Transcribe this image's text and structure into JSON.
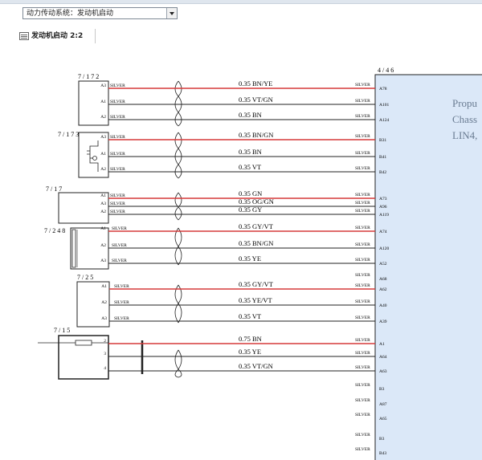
{
  "toolbar": {
    "system_select_value": "动力传动系统：发动机启动",
    "page_label": "发动机启动 2:2"
  },
  "ecu": {
    "id": "4 / 4 6",
    "text_lines": [
      "Propu",
      "Chass",
      "LIN4,"
    ]
  },
  "connectors": [
    {
      "id": "7 / 1 7 2"
    },
    {
      "id": "7 / 1 7 3"
    },
    {
      "id": "7 / 1 7"
    },
    {
      "id": "7 / 2 4 8"
    },
    {
      "id": "7 / 2 5"
    },
    {
      "id": "7 / 1 5"
    }
  ],
  "wires": [
    {
      "pin": "A3",
      "left_term": "SILVER",
      "label": "0.35 BN/YE",
      "right_term": "SILVER",
      "ecu_pin": "A78",
      "red": true
    },
    {
      "pin": "A1",
      "left_term": "SILVER",
      "label": "0.35 VT/GN",
      "right_term": "SILVER",
      "ecu_pin": "A101",
      "red": false
    },
    {
      "pin": "A2",
      "left_term": "SILVER",
      "label": "0.35 BN",
      "right_term": "SILVER",
      "ecu_pin": "A124",
      "red": false
    },
    {
      "pin": "A3",
      "left_term": "SILVER",
      "label": "0.35 BN/GN",
      "right_term": "SILVER",
      "ecu_pin": "B31",
      "red": true
    },
    {
      "pin": "A1",
      "left_term": "SILVER",
      "label": "0.35 BN",
      "right_term": "SILVER",
      "ecu_pin": "B41",
      "red": false
    },
    {
      "pin": "A2",
      "left_term": "SILVER",
      "label": "0.35 VT",
      "right_term": "SILVER",
      "ecu_pin": "B42",
      "red": false
    },
    {
      "pin": "A1",
      "left_term": "SILVER",
      "label": "0.35 GN",
      "right_term": "SILVER",
      "ecu_pin": "A73",
      "red": true
    },
    {
      "pin": "A3",
      "left_term": "SILVER",
      "label": "0.35 OG/GN",
      "right_term": "SILVER",
      "ecu_pin": "A96",
      "red": false
    },
    {
      "pin": "A2",
      "left_term": "SILVER",
      "label": "0.35 GY",
      "right_term": "SILVER",
      "ecu_pin": "A119",
      "red": false
    },
    {
      "pin": "A1",
      "left_term": "SILVER",
      "label": "0.35 GY/VT",
      "right_term": "SILVER",
      "ecu_pin": "A74",
      "red": true
    },
    {
      "pin": "A2",
      "left_term": "SILVER",
      "label": "0.35 BN/GN",
      "right_term": "SILVER",
      "ecu_pin": "A120",
      "red": false
    },
    {
      "pin": "A3",
      "left_term": "SILVER",
      "label": "0.35 YE",
      "right_term": "SILVER",
      "ecu_pin": "A52",
      "red": false
    },
    {
      "pin": "A1",
      "left_term": "SILVER",
      "label": "0.35 GY/VT",
      "right_term": "SILVER",
      "ecu_pin": "A62",
      "red": true
    },
    {
      "pin": "A2",
      "left_term": "SILVER",
      "label": "0.35 YE/VT",
      "right_term": "SILVER",
      "ecu_pin": "A40",
      "red": false
    },
    {
      "pin": "A3",
      "left_term": "SILVER",
      "label": "0.35 VT",
      "right_term": "SILVER",
      "ecu_pin": "A39",
      "red": false
    },
    {
      "pin": "2",
      "left_term": "",
      "label": "0.75 BN",
      "right_term": "SILVER",
      "ecu_pin": "A1",
      "red": true
    },
    {
      "pin": "3",
      "left_term": "",
      "label": "0.35 YE",
      "right_term": "SILVER",
      "ecu_pin": "A64",
      "red": false
    },
    {
      "pin": "4",
      "left_term": "",
      "label": "0.35 VT/GN",
      "right_term": "SILVER",
      "ecu_pin": "A63",
      "red": false
    }
  ],
  "unconnected_pins": [
    {
      "right_term": "SILVER",
      "ecu_pin": "A68"
    },
    {
      "right_term": "SILVER",
      "ecu_pin": "B3"
    },
    {
      "right_term": "SILVER",
      "ecu_pin": "A87"
    },
    {
      "right_term": "SILVER",
      "ecu_pin": "A65"
    },
    {
      "right_term": "SILVER",
      "ecu_pin": "B3"
    },
    {
      "right_term": "SILVER",
      "ecu_pin": "B43"
    }
  ],
  "colors": {
    "wire": "#222222",
    "highlight_wire": "#d63a3a",
    "ecu_fill": "#dbe8f8",
    "ecu_text": "#6a7c92"
  }
}
